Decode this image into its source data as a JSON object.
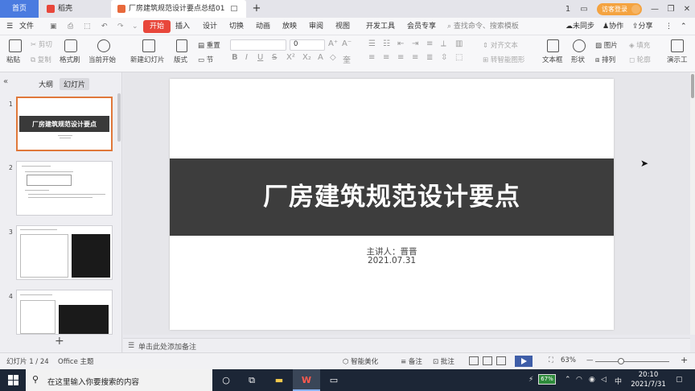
{
  "tabs": {
    "home": "首页",
    "daoke": "稻壳",
    "doc": "厂房建筑规范设计要点总结01",
    "add": "+"
  },
  "window": {
    "login": "访客登录",
    "win_icons": [
      "1",
      "▭",
      "—",
      "❐",
      "✕"
    ]
  },
  "menu": {
    "file": "文件",
    "start": "开始",
    "items": [
      "插入",
      "设计",
      "切换",
      "动画",
      "放映",
      "审阅",
      "视图",
      "开发工具",
      "会员专享"
    ],
    "search_placeholder": "查找命令、搜索模板",
    "sync": "未同步",
    "collab": "协作",
    "share": "分享"
  },
  "toolbar": {
    "paste": "粘贴",
    "cut": "剪切",
    "copy": "复制",
    "format_painter": "格式刷",
    "from_start": "当前开始",
    "new_slide": "新建幻灯片",
    "layout": "版式",
    "section": "节",
    "reset": "重置",
    "font_name": "",
    "font_size": "0",
    "bold": "B",
    "italic": "I",
    "underline": "U",
    "strike": "S",
    "align_text": "对齐文本",
    "convert_smartart": "转智能图形",
    "textbox": "文本框",
    "shape": "形状",
    "picture": "图片",
    "arrange": "排列",
    "fill": "填充",
    "outline": "轮廓",
    "present": "演示工"
  },
  "panel": {
    "outline_tab": "大纲",
    "slides_tab": "幻灯片",
    "add": "+",
    "thumb1_title": "厂房建筑规范设计要点"
  },
  "slide": {
    "title": "厂房建筑规范设计要点",
    "presenter": "主讲人：晋晋",
    "date": "2021.07.31"
  },
  "notes": {
    "placeholder": "单击此处添加备注"
  },
  "status": {
    "slide_counter": "幻灯片 1 / 24",
    "theme": "Office 主题",
    "beautify": "智能美化",
    "notes": "备注",
    "comment": "批注",
    "zoom": "63%",
    "minus": "—",
    "plus": "+"
  },
  "taskbar": {
    "search_placeholder": "在这里输入你要搜索的内容",
    "battery": "67%",
    "ime": "中",
    "time": "20:10",
    "date": "2021/7/31"
  }
}
